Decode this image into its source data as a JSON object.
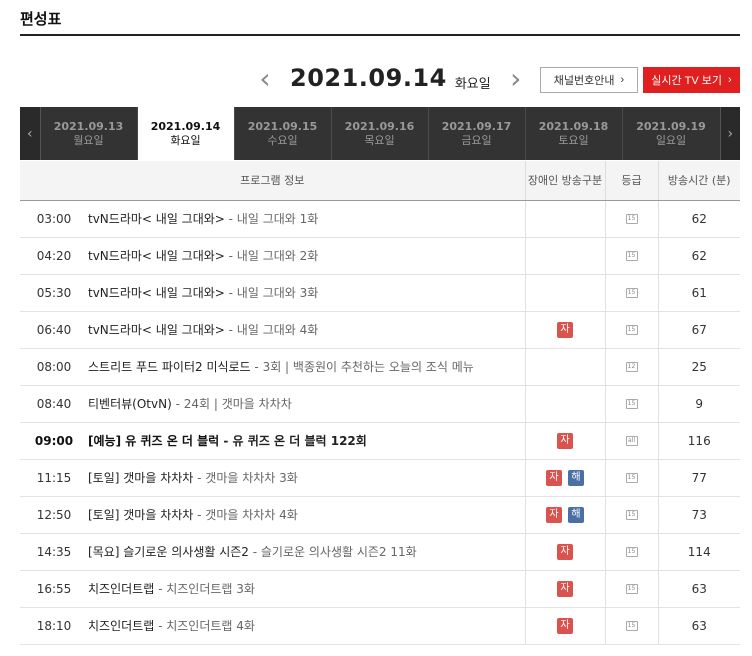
{
  "page": {
    "title": "편성표"
  },
  "date_nav": {
    "prev_icon": "chevron-left-icon",
    "next_icon": "chevron-right-icon",
    "date": "2021.09.14",
    "weekday": "화요일"
  },
  "buttons": {
    "channel_guide": "채널번호안내",
    "live_tv": "실시간 TV 보기",
    "chevron": "›"
  },
  "day_strip": {
    "prev": "‹",
    "next": "›",
    "tabs": [
      {
        "date": "2021.09.13",
        "day": "월요일"
      },
      {
        "date": "2021.09.14",
        "day": "화요일"
      },
      {
        "date": "2021.09.15",
        "day": "수요일"
      },
      {
        "date": "2021.09.16",
        "day": "목요일"
      },
      {
        "date": "2021.09.17",
        "day": "금요일"
      },
      {
        "date": "2021.09.18",
        "day": "토요일"
      },
      {
        "date": "2021.09.19",
        "day": "일요일"
      }
    ],
    "active_index": 1
  },
  "table": {
    "headers": {
      "program": "프로그램 정보",
      "accessibility": "장애인 방송구분",
      "rating": "등급",
      "duration": "방송시간 (분)"
    },
    "rows": [
      {
        "time": "03:00",
        "name": "tvN드라마< 내일 그대와>",
        "sub": " - 내일 그대와 1화",
        "badges": [],
        "rating": "15",
        "duration": "62",
        "bold": false
      },
      {
        "time": "04:20",
        "name": "tvN드라마< 내일 그대와>",
        "sub": " - 내일 그대와 2화",
        "badges": [],
        "rating": "15",
        "duration": "62",
        "bold": false
      },
      {
        "time": "05:30",
        "name": "tvN드라마< 내일 그대와>",
        "sub": " - 내일 그대와 3화",
        "badges": [],
        "rating": "15",
        "duration": "61",
        "bold": false
      },
      {
        "time": "06:40",
        "name": "tvN드라마< 내일 그대와>",
        "sub": " - 내일 그대와 4화",
        "badges": [
          "자"
        ],
        "rating": "15",
        "duration": "67",
        "bold": false
      },
      {
        "time": "08:00",
        "name": "스트리트 푸드 파이터2 미식로드",
        "sub": " - 3회 | 백종원이 추천하는 오늘의 조식 메뉴",
        "badges": [],
        "rating": "12",
        "duration": "25",
        "bold": false
      },
      {
        "time": "08:40",
        "name": "티벤터뷰(OtvN)",
        "sub": " - 24회 | 갯마을 차차차",
        "badges": [],
        "rating": "15",
        "duration": "9",
        "bold": false
      },
      {
        "time": "09:00",
        "name": "[예능] 유 퀴즈 온 더 블럭",
        "sub": " - 유 퀴즈 온 더 블럭 122회",
        "badges": [
          "자"
        ],
        "rating": "all",
        "duration": "116",
        "bold": true
      },
      {
        "time": "11:15",
        "name": "[토일] 갯마을 차차차",
        "sub": " - 갯마을 차차차 3화",
        "badges": [
          "자",
          "해"
        ],
        "rating": "15",
        "duration": "77",
        "bold": false
      },
      {
        "time": "12:50",
        "name": "[토일] 갯마을 차차차",
        "sub": " - 갯마을 차차차 4화",
        "badges": [
          "자",
          "해"
        ],
        "rating": "15",
        "duration": "73",
        "bold": false
      },
      {
        "time": "14:35",
        "name": "[목요] 슬기로운 의사생활 시즌2",
        "sub": " - 슬기로운 의사생활 시즌2 11화",
        "badges": [
          "자"
        ],
        "rating": "15",
        "duration": "114",
        "bold": false
      },
      {
        "time": "16:55",
        "name": "치즈인더트랩",
        "sub": " - 치즈인더트랩 3화",
        "badges": [
          "자"
        ],
        "rating": "15",
        "duration": "63",
        "bold": false
      },
      {
        "time": "18:10",
        "name": "치즈인더트랩",
        "sub": " - 치즈인더트랩 4화",
        "badges": [
          "자"
        ],
        "rating": "15",
        "duration": "63",
        "bold": false
      }
    ]
  },
  "colors": {
    "live_button": "#e02020",
    "badge_ja": "#d9534f",
    "badge_hae": "#4a6fa5",
    "strip_bg": "#333333"
  }
}
